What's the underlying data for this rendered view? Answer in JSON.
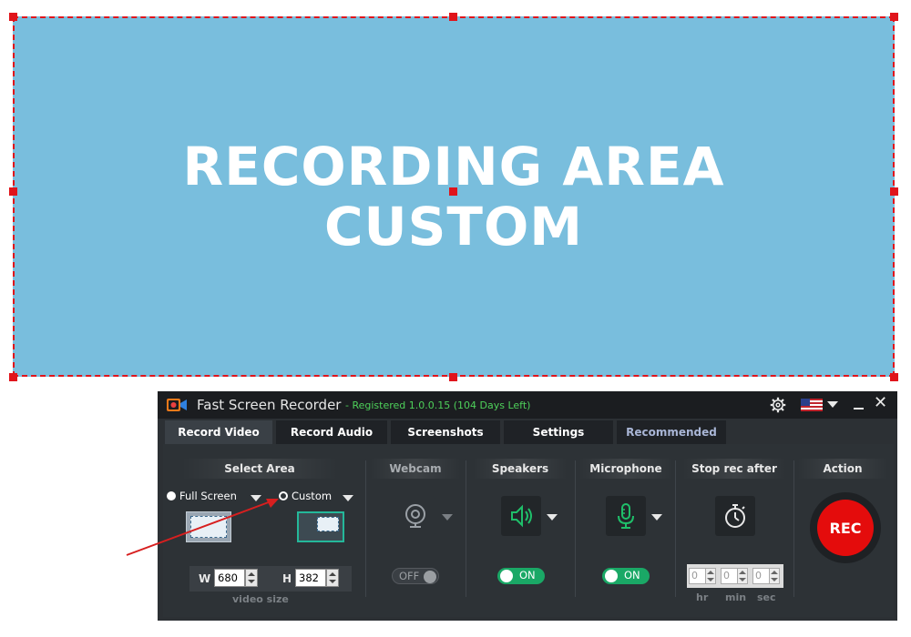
{
  "recording_area": {
    "line1": "RECORDING AREA",
    "line2": "CUSTOM"
  },
  "app": {
    "title": "Fast Screen Recorder",
    "registration": "- Registered 1.0.0.15 (104 Days Left)",
    "icons": {
      "logo": "camera-icon",
      "settings": "gear-icon",
      "language": "us-flag-icon",
      "minimize": "minimize-icon",
      "close": "close-icon"
    },
    "close_glyph": "✕"
  },
  "tabs": [
    {
      "label": "Record Video",
      "active": true
    },
    {
      "label": "Record Audio",
      "active": false
    },
    {
      "label": "Screenshots",
      "active": false
    },
    {
      "label": "Settings",
      "active": false
    },
    {
      "label": "Recommended",
      "active": false
    }
  ],
  "select_area": {
    "heading": "Select Area",
    "full_screen_label": "Full Screen",
    "custom_label": "Custom",
    "selected": "custom",
    "width_label": "W",
    "width_value": "680",
    "height_label": "H",
    "height_value": "382",
    "caption": "video size"
  },
  "webcam": {
    "heading": "Webcam",
    "toggle_label": "OFF",
    "state": "off"
  },
  "speakers": {
    "heading": "Speakers",
    "toggle_label": "ON",
    "state": "on"
  },
  "microphone": {
    "heading": "Microphone",
    "toggle_label": "ON",
    "state": "on"
  },
  "stop_rec": {
    "heading": "Stop rec after",
    "hr_value": "0",
    "min_value": "0",
    "sec_value": "0",
    "hr_label": "hr",
    "min_label": "min",
    "sec_label": "sec"
  },
  "action": {
    "heading": "Action",
    "rec_label": "REC"
  },
  "colors": {
    "recording_area_fill": "#79bedd",
    "selection_border": "#e0141b",
    "toggle_on": "#1aa866",
    "rec_button": "#e40c0c",
    "registered_text": "#4ed05a",
    "annotation_arrow": "#d71f1f"
  }
}
